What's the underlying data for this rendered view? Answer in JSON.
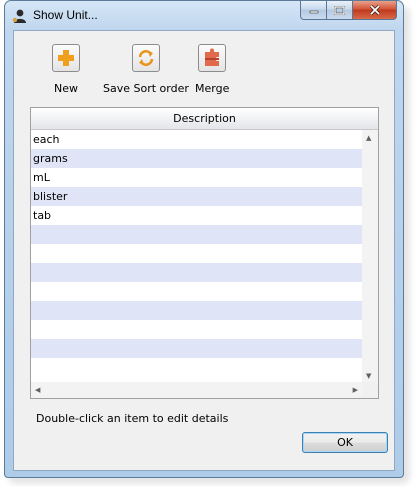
{
  "window": {
    "title": "Show Unit..."
  },
  "toolbar": {
    "new_label": "New",
    "save_sort_label": "Save Sort order",
    "merge_label": "Merge"
  },
  "grid": {
    "header": "Description",
    "rows": [
      "each",
      "grams",
      "mL",
      "blister",
      "tab",
      "",
      "",
      "",
      "",
      "",
      "",
      "",
      ""
    ]
  },
  "hint": "Double-click an item to edit details",
  "ok_label": "OK",
  "colors": {
    "row_alt": "#dfe4f6",
    "title_bar": "#c4dbf1",
    "close_button": "#c8452a"
  },
  "icons": [
    "user-icon",
    "plus-icon",
    "sort-refresh-icon",
    "merge-puzzle-icon"
  ]
}
